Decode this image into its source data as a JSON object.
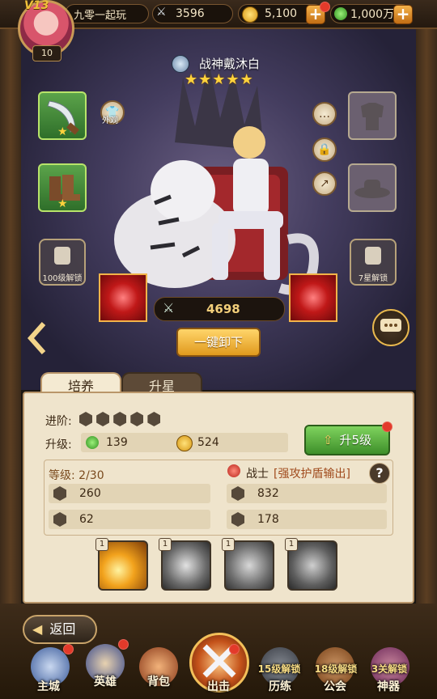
{
  "player": {
    "vip": "V13",
    "level": "10",
    "name": "九零一起玩"
  },
  "resources": {
    "power": "3596",
    "gold": "5,100",
    "potion": "1,000万"
  },
  "hero": {
    "name": "战神戴沐白",
    "stars": 5,
    "power": "4698"
  },
  "scene": {
    "appearance_label": "外观",
    "lock_100": "100级解锁",
    "lock_7star": "7星解锁",
    "unequip_all": "一键卸下"
  },
  "tabs": {
    "cultivate": "培养",
    "star_up": "升星"
  },
  "stats": {
    "advance_label": "进阶:",
    "upgrade_label": "升级:",
    "upgrade_cost_potion": "139",
    "upgrade_cost_gold": "524",
    "upgrade_button": "升5级",
    "level_label": "等级: 2/30",
    "class_name": "战士",
    "class_desc": "[强攻护盾输出]",
    "attack": "260",
    "defense": "62",
    "hp": "832",
    "speed": "178"
  },
  "skills": [
    {
      "level": "1"
    },
    {
      "level": "1"
    },
    {
      "level": "1"
    },
    {
      "level": "1"
    }
  ],
  "back_label": "返回",
  "nav": [
    {
      "label": "主城",
      "lock": ""
    },
    {
      "label": "英雄",
      "lock": ""
    },
    {
      "label": "背包",
      "lock": ""
    },
    {
      "label": "出击",
      "lock": ""
    },
    {
      "label": "历练",
      "lock": "15级解锁"
    },
    {
      "label": "公会",
      "lock": "18级解锁"
    },
    {
      "label": "神器",
      "lock": "3关解锁"
    }
  ],
  "colors": {
    "accent_gold": "#f0b54a",
    "scene_bg": "#433c5e",
    "panel_bg": "#efe4cc",
    "upgrade_green": "#4fa33a"
  }
}
